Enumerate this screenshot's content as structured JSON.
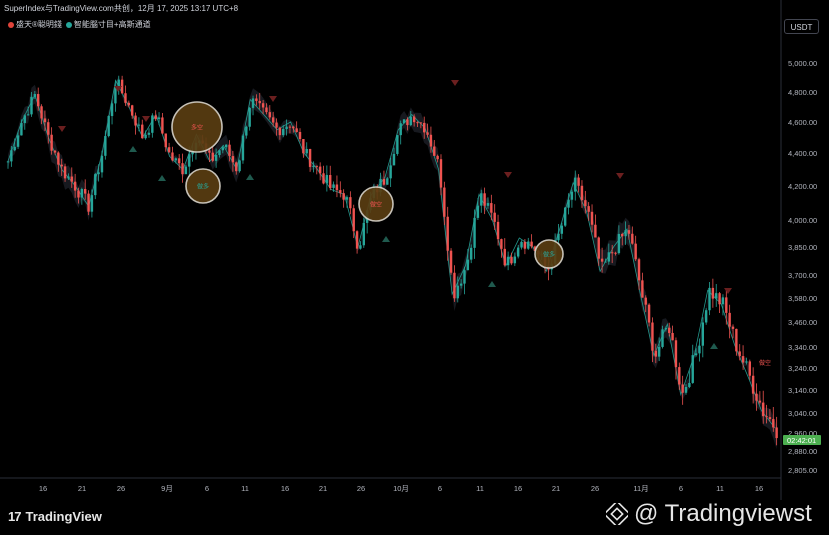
{
  "header": {
    "attribution": "SuperIndex与TradingView.com共创，12月 17, 2025 13:17 UTC+8"
  },
  "indicators": [
    {
      "label": "盛天®聪明錢",
      "icon": "flame-icon",
      "color": "#e0443a"
    },
    {
      "label": "智能腦寸目+高斯通道",
      "icon": "circle-icon",
      "color": "#26a69a"
    }
  ],
  "currency_label": "USDT",
  "colors": {
    "up": "#26a69a",
    "down": "#ef5350",
    "band": "#2a2e39",
    "price_tag": "#4caf50",
    "signal_fill": "#5a3d12",
    "signal_stroke": "#d7d2c7"
  },
  "price_axis": {
    "labels": [
      "5,000.00",
      "4,800.00",
      "4,600.00",
      "4,400.00",
      "4,200.00",
      "4,000.00",
      "3,850.00",
      "3,700.00",
      "3,580.00",
      "3,460.00",
      "3,340.00",
      "3,240.00",
      "3,140.00",
      "3,040.00",
      "2,960.00",
      "2,880.00",
      "2,805.00"
    ],
    "current_price_label": "02:42:01"
  },
  "time_axis": {
    "labels": [
      "16",
      "21",
      "26",
      "9月",
      "6",
      "11",
      "16",
      "21",
      "26",
      "10月",
      "6",
      "11",
      "16",
      "21",
      "26",
      "11月",
      "6",
      "11",
      "16"
    ]
  },
  "chart_data": {
    "type": "candlestick",
    "series_close": [
      4350,
      4600,
      4780,
      4500,
      4300,
      4200,
      4080,
      4400,
      4880,
      4700,
      4500,
      4650,
      4380,
      4300,
      4520,
      4350,
      4450,
      4300,
      4750,
      4650,
      4550,
      4600,
      4400,
      4300,
      4180,
      4150,
      3850,
      4150,
      4250,
      4550,
      4650,
      4560,
      4300,
      3600,
      3750,
      4150,
      4000,
      3750,
      3900,
      3850,
      3720,
      3950,
      4220,
      4050,
      3720,
      3850,
      3950,
      3600,
      3300,
      3450,
      3120,
      3300,
      3620,
      3550,
      3350,
      3200,
      3050,
      2980
    ],
    "signals": [
      {
        "label": "多空",
        "color": "#ef5350"
      },
      {
        "label": "做多",
        "color": "#26a69a"
      },
      {
        "label": "做空",
        "color": "#ef5350"
      },
      {
        "label": "做多",
        "color": "#26a69a"
      }
    ],
    "right_marker_label": "做空"
  },
  "footer": {
    "brand": "TradingView",
    "watermark": "@ Tradingviewst"
  }
}
